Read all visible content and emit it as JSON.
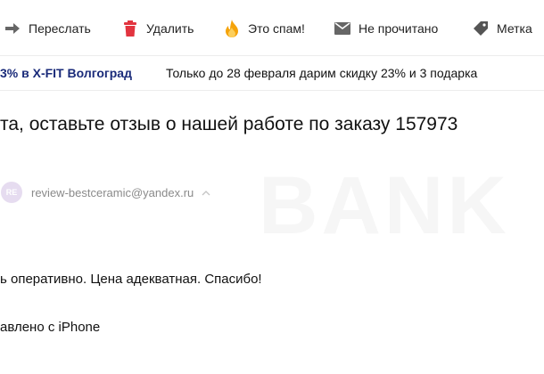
{
  "toolbar": {
    "forward": "Переслать",
    "delete": "Удалить",
    "spam": "Это спам!",
    "unread": "Не прочитано",
    "label": "Метка"
  },
  "promo": {
    "sender": "3% в X-FIT Волгоград",
    "snippet": "Только до 28 февраля дарим скидку 23% и 3 подарка"
  },
  "message": {
    "subject": "та, оставьте отзыв о нашей работе по заказу 157973",
    "avatar_initials": "RE",
    "from_email": "review-bestceramic@yandex.ru",
    "body_line1": "ь оперативно. Цена адекватная. Спасибо!",
    "body_line2": "авлено с iPhone"
  },
  "colors": {
    "spam_icon": "#f5a30b",
    "delete_icon": "#e2343f",
    "promo_sender": "#1a2b7a",
    "avatar_bg": "#e6dcf0"
  },
  "icons": [
    "arrow-right-icon",
    "trash-icon",
    "flame-icon",
    "envelope-icon",
    "tag-icon",
    "chevron-up-icon"
  ]
}
